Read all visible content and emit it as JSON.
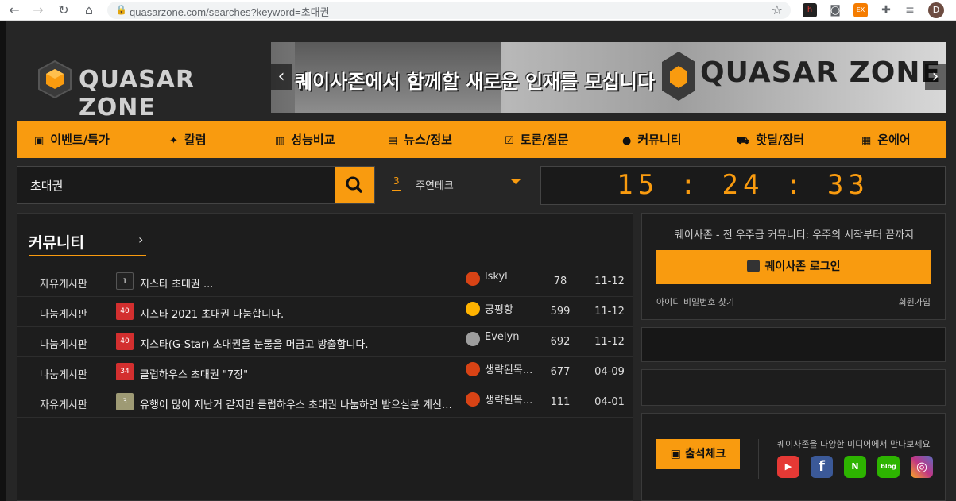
{
  "browser": {
    "url": "quasarzone.com/searches?keyword=초대권",
    "profile_initial": "D",
    "ext_badge": "EX"
  },
  "site": {
    "logo_text": "QUASAR ZONE",
    "banner_text": "퀘이사존에서 함께할 새로운 인재를 모십니다",
    "banner_logo": "QUASAR ZONE",
    "nav": [
      {
        "label": "이벤트/특가",
        "icon": "gift-icon"
      },
      {
        "label": "칼럼",
        "icon": "satellite-icon"
      },
      {
        "label": "성능비교",
        "icon": "chart-icon"
      },
      {
        "label": "뉴스/정보",
        "icon": "news-icon"
      },
      {
        "label": "토론/질문",
        "icon": "check-chat-icon"
      },
      {
        "label": "커뮤니티",
        "icon": "chat-icon"
      },
      {
        "label": "핫딜/장터",
        "icon": "cart-icon"
      },
      {
        "label": "온에어",
        "icon": "tv-icon"
      }
    ],
    "search": {
      "value": "초대권",
      "button": "search-icon"
    },
    "ranking": {
      "rank": "3",
      "keyword": "주연테크"
    },
    "clock": "15 : 24 : 33"
  },
  "community": {
    "title": "커뮤니티",
    "more": "›",
    "rows": [
      {
        "board": "자유게시판",
        "badge": "1",
        "badge_color": "#222222",
        "title": "지스타 초대권 ...",
        "nick": "lskyl",
        "avatar": "#d84315",
        "views": "78",
        "date": "11-12"
      },
      {
        "board": "나눔게시판",
        "badge": "40",
        "badge_color": "#d32f2f",
        "title": "지스타 2021 초대권 나눔합니다.",
        "nick": "궁평항",
        "avatar": "#ffb300",
        "views": "599",
        "date": "11-12"
      },
      {
        "board": "나눔게시판",
        "badge": "40",
        "badge_color": "#d32f2f",
        "title": "지스타(G-Star) 초대권을 눈물을 머금고 방출합니다.",
        "nick": "Evelyn",
        "avatar": "#9e9e9e",
        "views": "692",
        "date": "11-12"
      },
      {
        "board": "나눔게시판",
        "badge": "34",
        "badge_color": "#d32f2f",
        "title": "클럽하우스 초대권 \"7장\"",
        "nick": "생략된목...",
        "avatar": "#d84315",
        "views": "677",
        "date": "04-09"
      },
      {
        "board": "자유게시판",
        "badge": "3",
        "badge_color": "#9e9a74",
        "title": "유행이 많이 지난거 같지만 클럽하우스 초대권 나눔하면 받으실분 계신가요?",
        "nick": "생략된목...",
        "avatar": "#d84315",
        "views": "111",
        "date": "04-01"
      }
    ]
  },
  "login": {
    "desc": "퀘이사존  -  전 우주급 커뮤니티: 우주의 시작부터 끝까지",
    "button": "퀘이사존 로그인",
    "find": "아이디 비밀번호 찾기",
    "join": "회원가입"
  },
  "attendance": {
    "button": "출석체크",
    "media_desc": "퀘이사존을 다양한 미디어에서 만나보세요",
    "social": [
      {
        "name": "youtube-icon",
        "color": "#e53935",
        "glyph": "▶"
      },
      {
        "name": "facebook-icon",
        "color": "#3b5998",
        "glyph": "f"
      },
      {
        "name": "naver-post-icon",
        "color": "#2db400",
        "glyph": "N"
      },
      {
        "name": "blog-icon",
        "color": "#2db400",
        "glyph": "blog"
      },
      {
        "name": "instagram-icon",
        "color": "#c13584",
        "glyph": "◎"
      }
    ]
  }
}
